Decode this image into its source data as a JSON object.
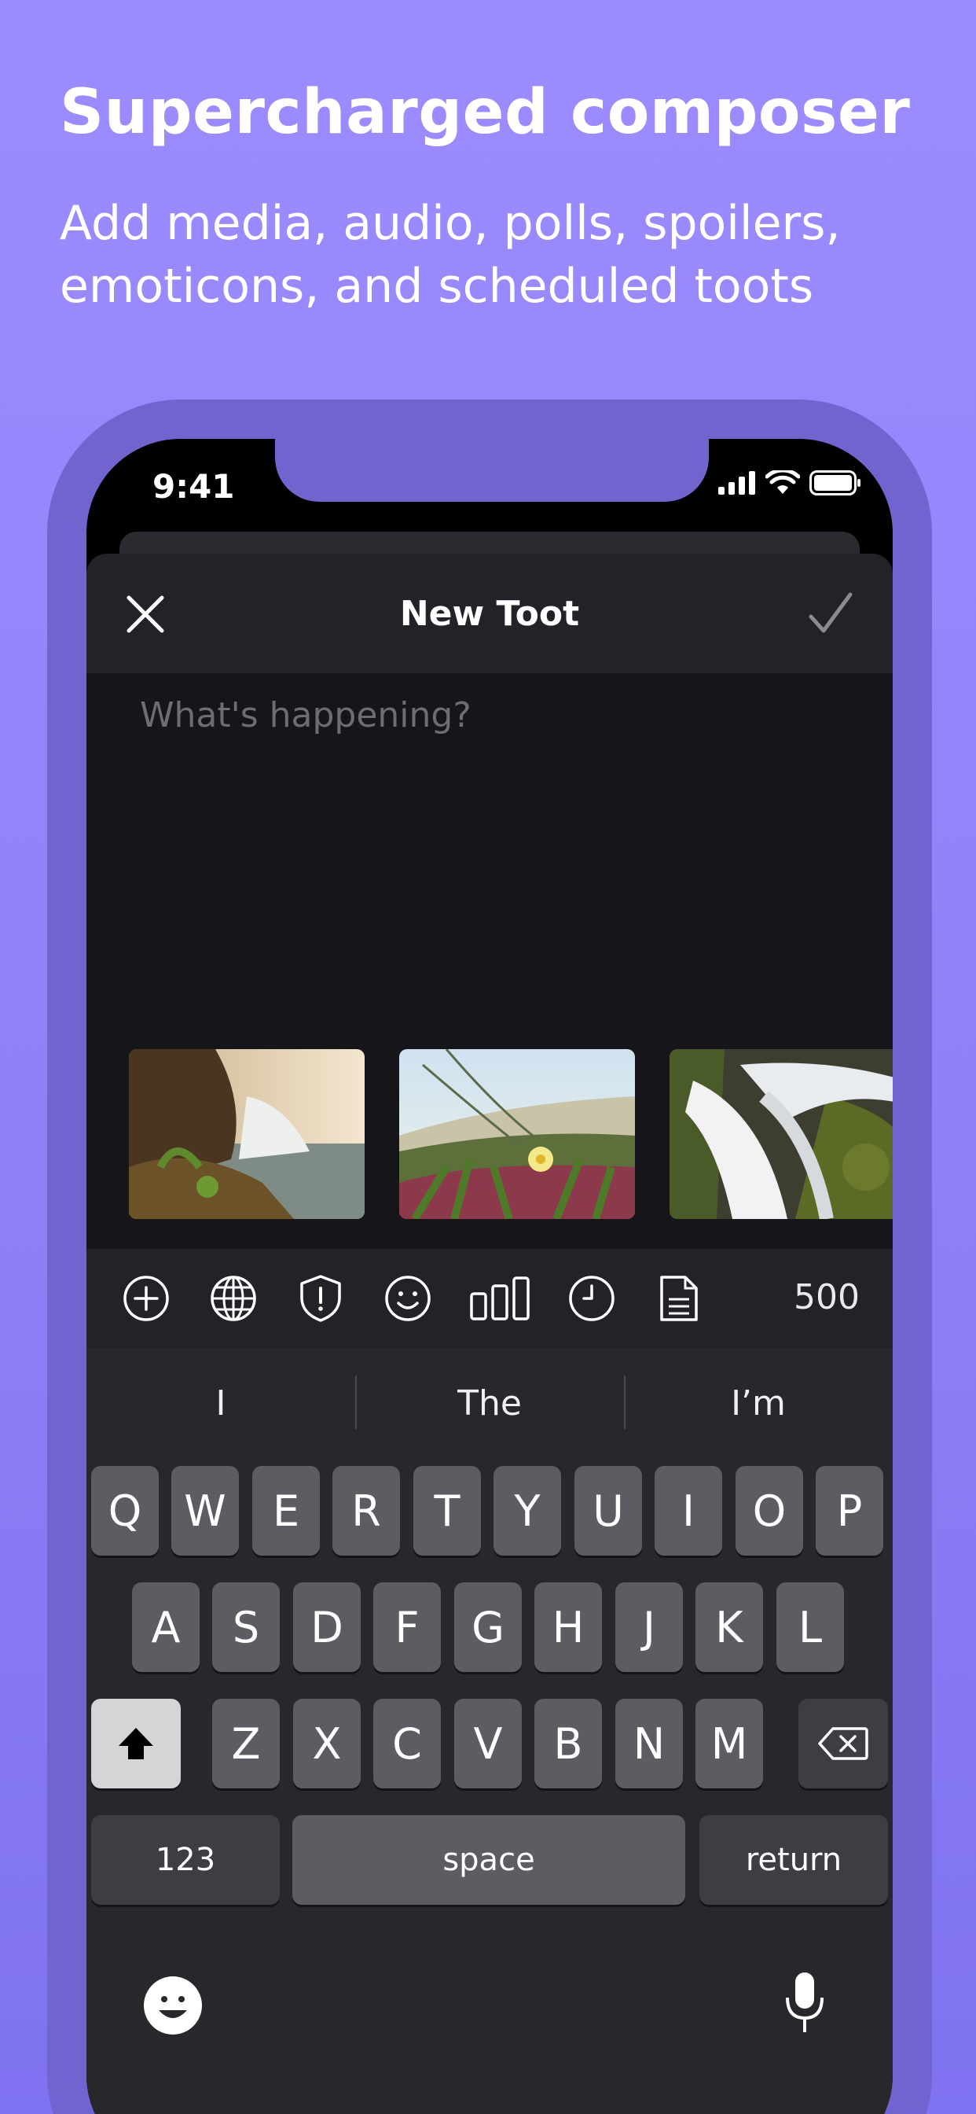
{
  "promo": {
    "headline": "Supercharged composer",
    "subhead": "Add media, audio, polls, spoilers, emoticons, and scheduled toots"
  },
  "status_bar": {
    "time": "9:41"
  },
  "composer": {
    "title": "New Toot",
    "placeholder": "What's happening?",
    "char_count": "500",
    "attachments": [
      {
        "name": "waterfall-cliff-photo"
      },
      {
        "name": "flower-grass-photo"
      },
      {
        "name": "waterfall-rocks-photo"
      }
    ],
    "toolbar_icons": [
      "add-icon",
      "globe-icon",
      "shield-alert-icon",
      "emoji-icon",
      "poll-icon",
      "clock-icon",
      "document-icon"
    ]
  },
  "keyboard": {
    "suggestions": [
      "I",
      "The",
      "I’m"
    ],
    "row1": [
      "Q",
      "W",
      "E",
      "R",
      "T",
      "Y",
      "U",
      "I",
      "O",
      "P"
    ],
    "row2": [
      "A",
      "S",
      "D",
      "F",
      "G",
      "H",
      "J",
      "K",
      "L"
    ],
    "row3": [
      "Z",
      "X",
      "C",
      "V",
      "B",
      "N",
      "M"
    ],
    "numbers_label": "123",
    "space_label": "space",
    "return_label": "return"
  }
}
